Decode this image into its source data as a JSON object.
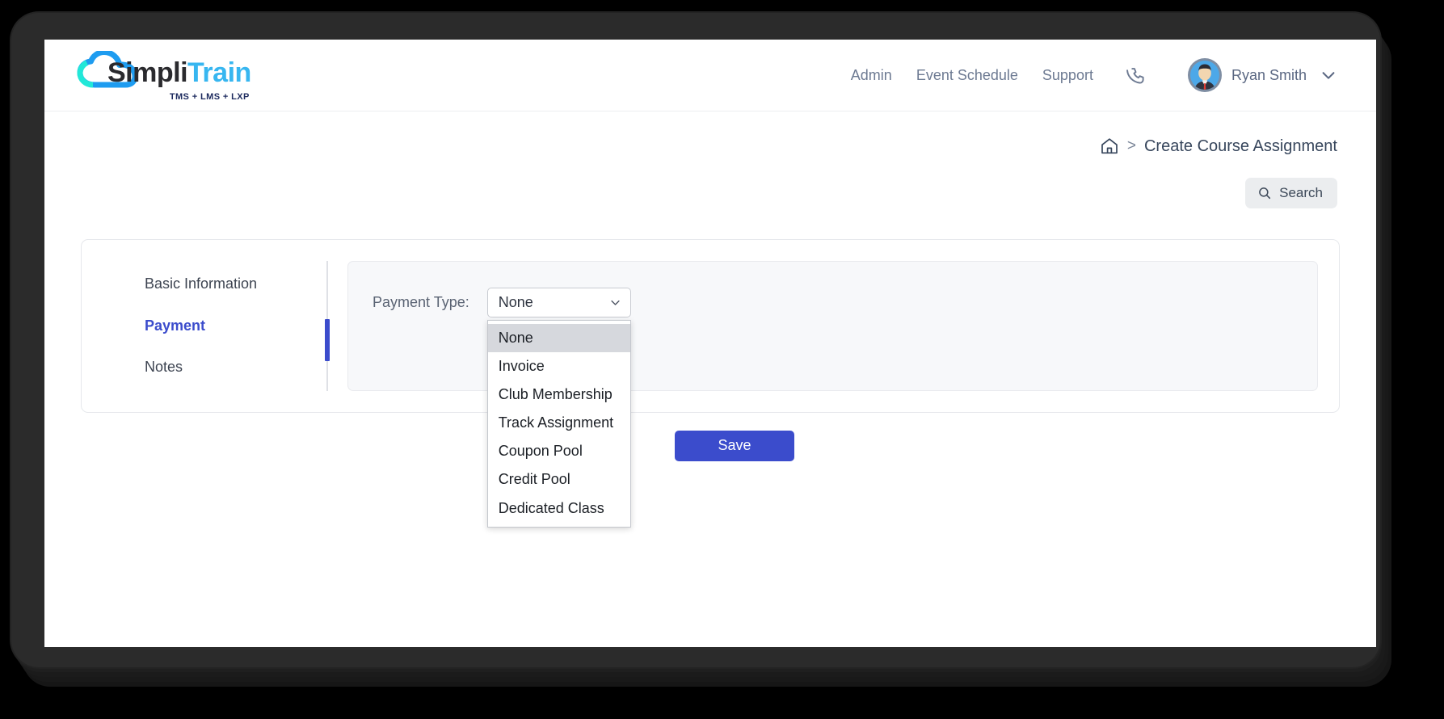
{
  "brand": {
    "name_part1": "Simpli",
    "name_part2": "Train",
    "tagline": "TMS + LMS + LXP",
    "cloud_color": "#1e9cf0",
    "cloud_accent_color": "#22e8d8",
    "wordmark_dark": "#2a2a2e",
    "wordmark_light": "#37b6f0"
  },
  "header": {
    "nav": [
      {
        "label": "Admin"
      },
      {
        "label": "Event Schedule"
      },
      {
        "label": "Support"
      }
    ],
    "phone_icon": "phone-icon",
    "user": {
      "name": "Ryan Smith",
      "avatar_icon": "user-avatar",
      "caret_icon": "chevron-down-icon"
    }
  },
  "breadcrumb": {
    "home_icon": "home-icon",
    "separator": ">",
    "current": "Create Course Assignment"
  },
  "search": {
    "icon": "search-icon",
    "label": "Search"
  },
  "form": {
    "steps": [
      {
        "label": "Basic Information",
        "active": false
      },
      {
        "label": "Payment",
        "active": true
      },
      {
        "label": "Notes",
        "active": false
      }
    ],
    "payment_type": {
      "label": "Payment Type:",
      "value": "None",
      "caret_icon": "chevron-down-icon",
      "open": true,
      "options": [
        "None",
        "Invoice",
        "Club Membership",
        "Track Assignment",
        "Coupon Pool",
        "Credit Pool",
        "Dedicated Class"
      ],
      "selected_index": 0
    },
    "save_label": "Save"
  },
  "colors": {
    "accent": "#3b4ccc",
    "panel_bg": "#f7f8fa",
    "search_bg": "#ebedef",
    "bezel": "#2b2b2b"
  }
}
